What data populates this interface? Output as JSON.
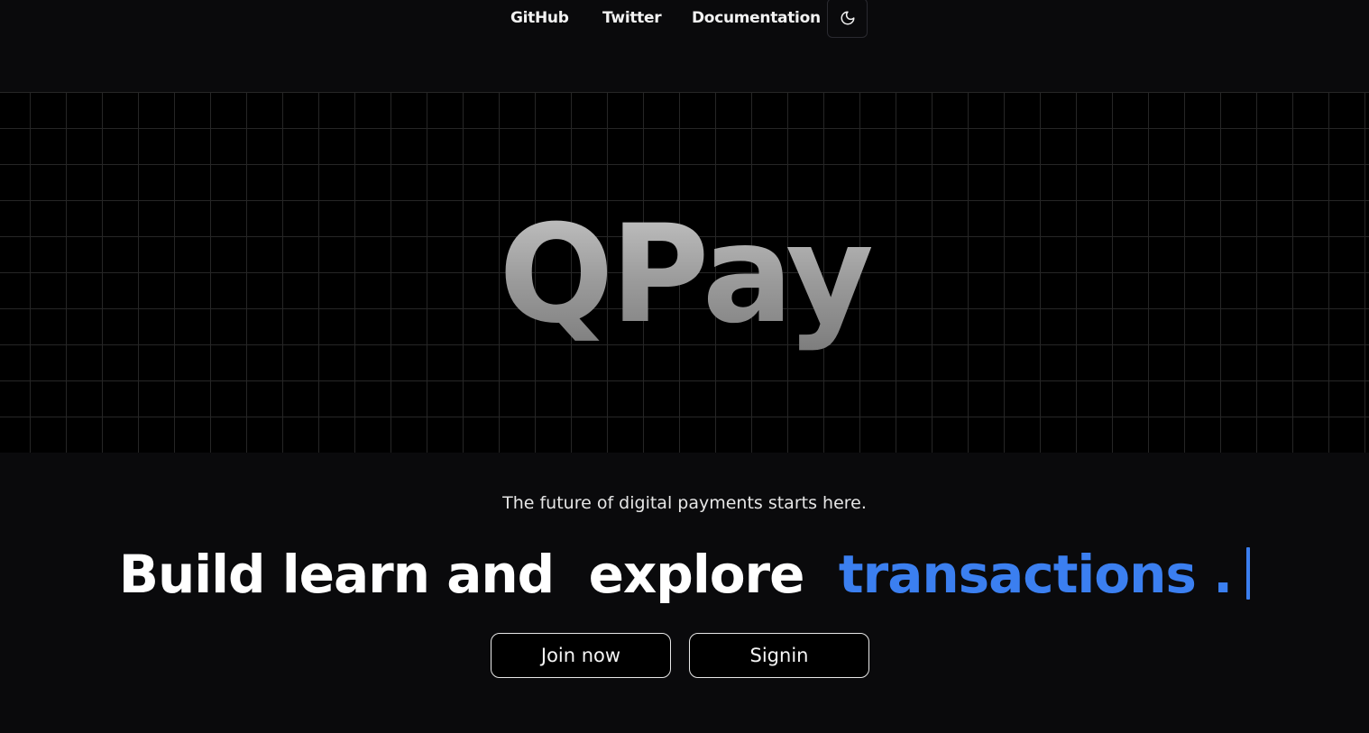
{
  "nav": {
    "links": [
      "GitHub",
      "Twitter",
      "Documentation"
    ],
    "theme_toggle_icon": "moon-icon"
  },
  "hero": {
    "title": "QPay"
  },
  "tagline": "The future of digital payments starts here.",
  "headline": {
    "part1": "Build learn and",
    "part2": "explore",
    "accent": "transactions .",
    "accent_color": "#3b7ff0"
  },
  "buttons": {
    "join": "Join now",
    "signin": "Signin"
  }
}
